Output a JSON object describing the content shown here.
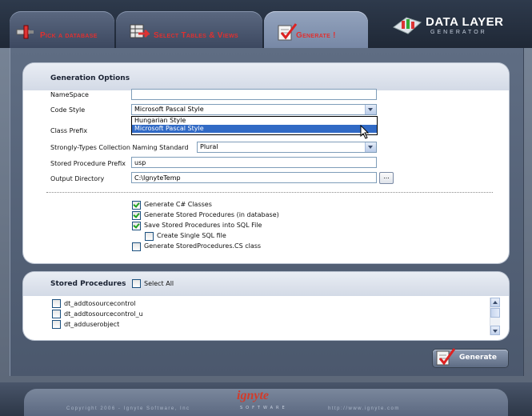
{
  "tabs": [
    {
      "label": "Pick a database",
      "icon": "database-plug-icon"
    },
    {
      "label": "Select Tables & Views",
      "icon": "tables-icon"
    },
    {
      "label": "Generate !",
      "icon": "checkmark-icon"
    }
  ],
  "brand": {
    "title": "DATA LAYER",
    "subtitle": "GENERATOR"
  },
  "generation_options": {
    "title": "Generation Options",
    "namespace_label": "NameSpace",
    "namespace_value": "",
    "code_style_label": "Code Style",
    "code_style_value": "Microsoft Pascal Style",
    "code_style_options": [
      "Hungarian Style",
      "Microsoft Pascal Style"
    ],
    "class_prefix_label": "Class Prefix",
    "collection_label": "Strongly-Types Collection Naming Standard",
    "collection_value": "Plural",
    "sp_prefix_label": "Stored Procedure Prefix",
    "sp_prefix_value": "usp",
    "output_dir_label": "Output Directory",
    "output_dir_value": "C:\\IgnyteTemp",
    "browse_label": "...",
    "options": [
      {
        "label": "Generate C# Classes",
        "checked": true
      },
      {
        "label": "Generate Stored Procedures (in database)",
        "checked": true
      },
      {
        "label": "Save Stored Procedures into SQL File",
        "checked": true
      },
      {
        "label": "Create Single SQL file",
        "checked": false
      },
      {
        "label": "Generate StoredProcedures.CS class",
        "checked": false
      }
    ]
  },
  "stored_procedures": {
    "title": "Stored Procedures",
    "select_all_label": "Select All",
    "items": [
      "dt_addtosourcecontrol",
      "dt_addtosourcecontrol_u",
      "dt_adduserobject"
    ]
  },
  "generate_button": "Generate",
  "footer": {
    "copyright": "Copyright 2006 - Ignyte Software, Inc",
    "url": "http://www.ignyte.com",
    "logo": "ignyte",
    "logo_sub": "SOFTWARE"
  },
  "colors": {
    "accent": "#e03030",
    "selection": "#316ac5",
    "check": "#21a121"
  }
}
